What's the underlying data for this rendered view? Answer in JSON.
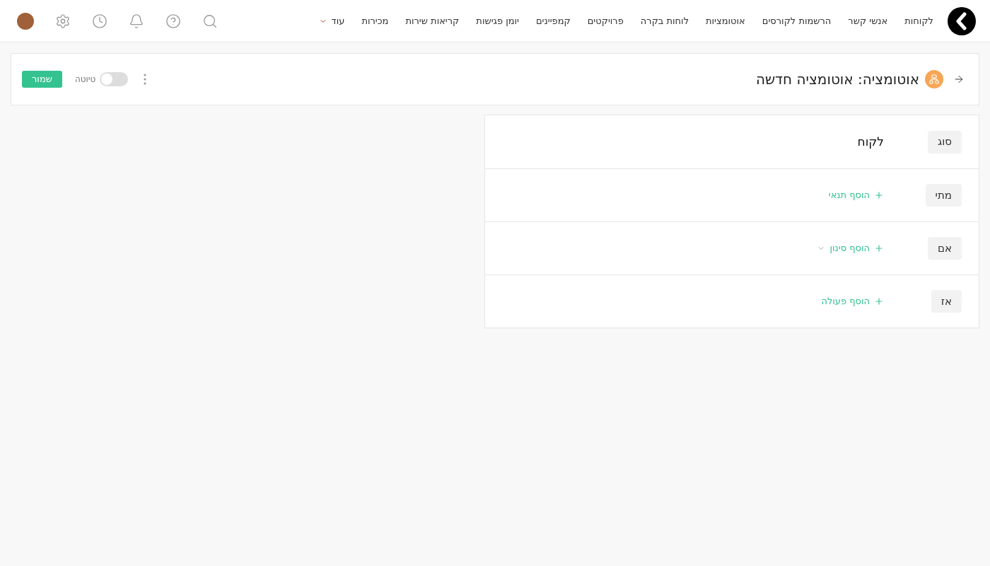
{
  "nav": {
    "items": [
      {
        "label": "לקוחות"
      },
      {
        "label": "אנשי קשר"
      },
      {
        "label": "הרשמות לקורסים"
      },
      {
        "label": "אוטומציות"
      },
      {
        "label": "לוחות בקרה"
      },
      {
        "label": "פרויקטים"
      },
      {
        "label": "קמפיינים"
      },
      {
        "label": "יומן פגישות"
      },
      {
        "label": "קריאות שירות"
      },
      {
        "label": "מכירות"
      }
    ],
    "more": "עוד"
  },
  "header": {
    "title": "אוטומציה: אוטומציה חדשה",
    "draft": {
      "label": "טיוטה",
      "on": false
    },
    "save": "שמור"
  },
  "rows": [
    {
      "label": "סוג",
      "kind": "value",
      "text": "לקוח"
    },
    {
      "label": "מתי",
      "kind": "add",
      "text": "הוסף תנאי",
      "dropdown": false
    },
    {
      "label": "אם",
      "kind": "add",
      "text": "הוסף סינון",
      "dropdown": true
    },
    {
      "label": "אז",
      "kind": "add",
      "text": "הוסף פעולה",
      "dropdown": false
    }
  ]
}
